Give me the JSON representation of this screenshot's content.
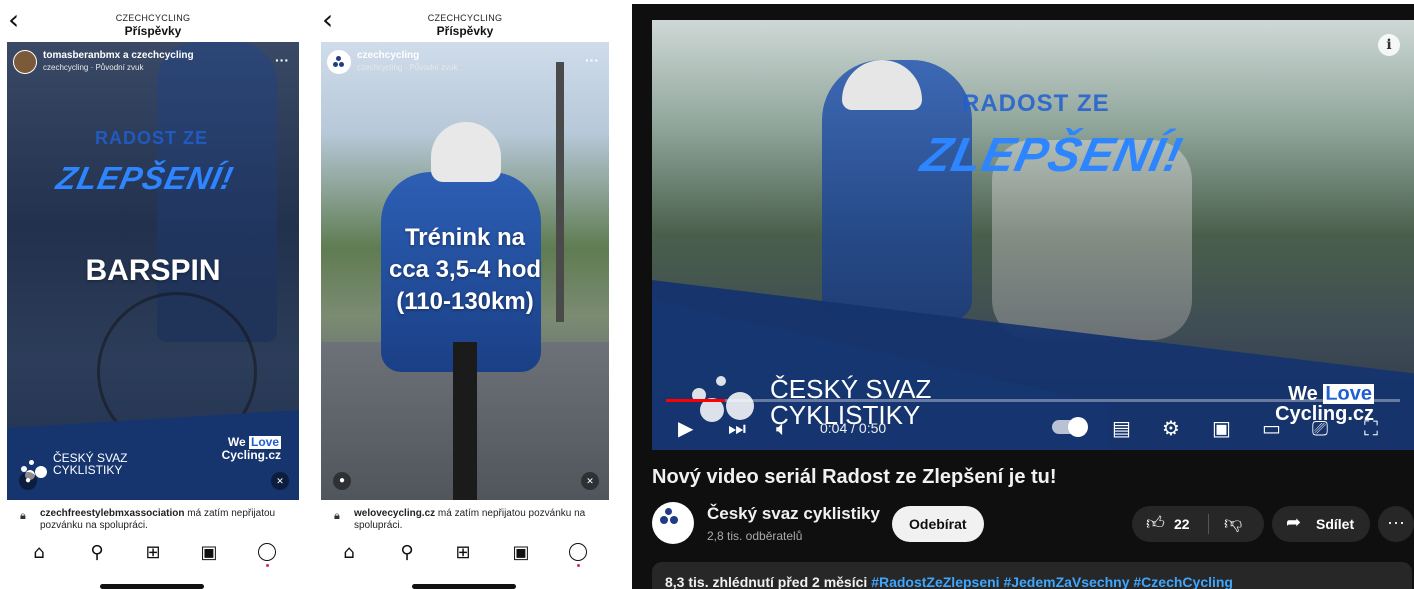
{
  "instagram": [
    {
      "header": {
        "account": "CZECHCYCLING",
        "title": "Příspěvky"
      },
      "post": {
        "user": "tomasberanbmx a czechcycling",
        "sub": "czechcycling · Původní zvuk",
        "brand_top": "RADOST ZE",
        "brand_main": "ZLEPŠENÍ!",
        "overlay": "BARSPIN",
        "logo_text": "ČESKÝ SVAZ CYKLISTIKY",
        "welove_top": "We",
        "welove_box": "Love",
        "welove_bottom": "Cycling.cz"
      },
      "collab": {
        "account": "czechfreestylebmxassociation",
        "message": " má zatím nepřijatou pozvánku na spolupráci."
      }
    },
    {
      "header": {
        "account": "CZECHCYCLING",
        "title": "Příspěvky"
      },
      "post": {
        "user": "czechcycling",
        "sub": "czechcycling · Původní zvuk",
        "overlay_lines": [
          "Trénink na",
          "cca 3,5-4 hod",
          "(110-130km)"
        ]
      },
      "collab": {
        "account": "welovecycling.cz",
        "message": " má zatím nepřijatou pozvánku na spolupráci."
      }
    }
  ],
  "youtube": {
    "video": {
      "brand_top": "RADOST ZE",
      "brand_main": "ZLEPŠENÍ!",
      "logo_text": "ČESKÝ SVAZ CYKLISTIKY",
      "welove_top": "We",
      "welove_box": "Love",
      "welove_bottom": "Cycling.cz",
      "time": "0:04 / 0:50",
      "progress": 0.08
    },
    "title": "Nový video seriál Radost ze Zlepšení je tu!",
    "channel": {
      "name": "Český svaz cyklistiky",
      "subs": "2,8 tis. odběratelů"
    },
    "subscribe_label": "Odebírat",
    "likes": "22",
    "share_label": "Sdílet",
    "description": {
      "meta": "8,3 tis. zhlédnutí  před 2 měsíci",
      "tags": "#RadostZeZlepseni #JedemZaVsechny #CzechCycling"
    }
  },
  "icons": {
    "back": "chevron-left-icon",
    "home": "home-icon",
    "search": "search-icon",
    "create": "plus-square-icon",
    "reels": "reels-icon",
    "profile": "profile-avatar-icon"
  }
}
